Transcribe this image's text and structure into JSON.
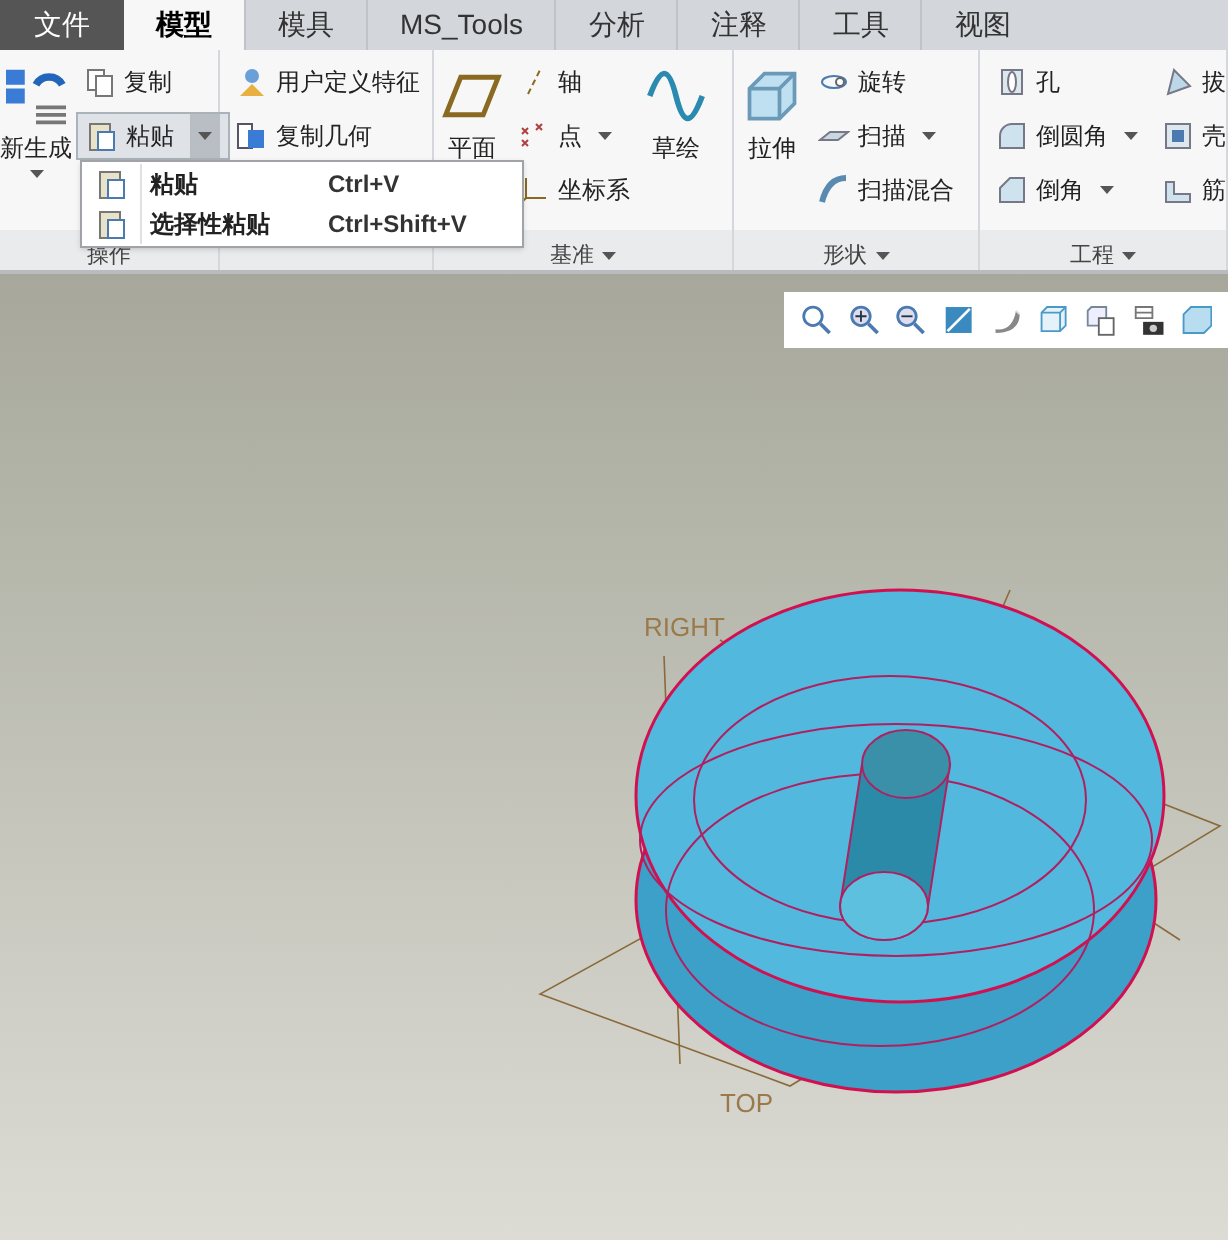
{
  "tabs": [
    {
      "label": "文件",
      "kind": "file",
      "selected": false
    },
    {
      "label": "模型",
      "kind": "tab",
      "selected": true
    },
    {
      "label": "模具",
      "kind": "tab",
      "selected": false
    },
    {
      "label": "MS_Tools",
      "kind": "tab",
      "selected": false
    },
    {
      "label": "分析",
      "kind": "tab",
      "selected": false
    },
    {
      "label": "注释",
      "kind": "tab",
      "selected": false
    },
    {
      "label": "工具",
      "kind": "tab",
      "selected": false
    },
    {
      "label": "视图",
      "kind": "tab",
      "selected": false
    }
  ],
  "ribbon": {
    "groups": [
      {
        "label": "操作",
        "menu": false,
        "columns": [
          [
            {
              "label": "新生成",
              "kind": "large",
              "dropdown": true,
              "pressed": false
            }
          ],
          [
            {
              "label": "复制",
              "kind": "small",
              "dropdown": false,
              "pressed": false
            },
            {
              "label": "粘贴",
              "kind": "small",
              "dropdown": true,
              "pressed": true
            }
          ]
        ]
      },
      {
        "menu": false,
        "columns": [
          [
            {
              "label": "用户定义特征",
              "kind": "small",
              "dropdown": false,
              "pressed": false
            },
            {
              "label": "复制几何",
              "kind": "small",
              "dropdown": false,
              "pressed": false
            }
          ]
        ]
      },
      {
        "label": "基准",
        "menu": true,
        "columns": [
          [
            {
              "label": "平面",
              "kind": "large",
              "dropdown": false,
              "pressed": false
            }
          ],
          [
            {
              "label": "轴",
              "kind": "small",
              "dropdown": false,
              "pressed": false
            },
            {
              "label": "点",
              "kind": "small",
              "dropdown": true,
              "pressed": false
            },
            {
              "label": "坐标系",
              "kind": "small",
              "dropdown": false,
              "pressed": false
            }
          ],
          [
            {
              "label": "草绘",
              "kind": "large",
              "dropdown": false,
              "pressed": false
            }
          ]
        ]
      },
      {
        "label": "形状",
        "menu": true,
        "columns": [
          [
            {
              "label": "拉伸",
              "kind": "large",
              "dropdown": false,
              "pressed": false
            }
          ],
          [
            {
              "label": "旋转",
              "kind": "small",
              "dropdown": false,
              "pressed": false
            },
            {
              "label": "扫描",
              "kind": "small",
              "dropdown": true,
              "pressed": false
            },
            {
              "label": "扫描混合",
              "kind": "small",
              "dropdown": false,
              "pressed": false
            }
          ]
        ]
      },
      {
        "label": "工程",
        "menu": true,
        "columns": [
          [
            {
              "label": "孔",
              "kind": "small",
              "dropdown": false,
              "pressed": false
            },
            {
              "label": "倒圆角",
              "kind": "small",
              "dropdown": true,
              "pressed": false
            },
            {
              "label": "倒角",
              "kind": "small",
              "dropdown": true,
              "pressed": false
            }
          ],
          [
            {
              "label": "拔",
              "kind": "small",
              "dropdown": false,
              "pressed": false
            },
            {
              "label": "壳",
              "kind": "small",
              "dropdown": false,
              "pressed": false
            },
            {
              "label": "筋",
              "kind": "small",
              "dropdown": false,
              "pressed": false
            }
          ]
        ]
      }
    ]
  },
  "paste_menu": {
    "items": [
      {
        "label": "粘贴",
        "shortcut": "Ctrl+V"
      },
      {
        "label": "选择性粘贴",
        "shortcut": "Ctrl+Shift+V"
      }
    ]
  },
  "viewport": {
    "datum_labels": [
      "RIGHT",
      "TOP"
    ]
  }
}
